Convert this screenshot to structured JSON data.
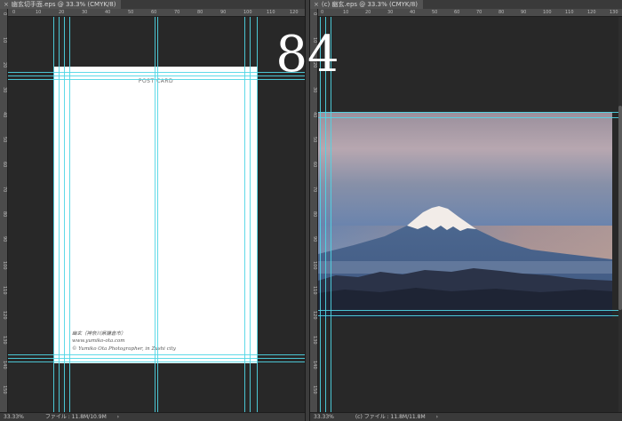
{
  "left_document": {
    "tab_title": "幽玄切手面.eps @ 33.3% (CMYK/8)",
    "ruler_top_ticks": [
      "0",
      "10",
      "20",
      "30",
      "40",
      "50",
      "60",
      "70",
      "80",
      "90",
      "100",
      "110",
      "120"
    ],
    "ruler_left_ticks": [
      "0",
      "10",
      "20",
      "30",
      "40",
      "50",
      "60",
      "70",
      "80",
      "90",
      "100",
      "110",
      "120",
      "130",
      "140",
      "150"
    ],
    "postcard": {
      "title": "POST CARD",
      "credit_lines": [
        "幽玄（神奈川県鎌倉市）",
        "www.yumiko-ota.com",
        "© Yumiko Ota Photographer, in Zushi city"
      ]
    },
    "status": {
      "zoom": "33.33%",
      "file_info": "ファイル : 11.8M/10.9M",
      "arrow": "›"
    }
  },
  "right_document": {
    "tab_title": "(c) 幽玄.eps @ 33.3% (CMYK/8)",
    "ruler_top_ticks": [
      "0",
      "10",
      "20",
      "30",
      "40",
      "50",
      "60",
      "70",
      "80",
      "90",
      "100",
      "110",
      "120",
      "130"
    ],
    "ruler_left_ticks": [
      "0",
      "10",
      "20",
      "30",
      "40",
      "50",
      "60",
      "70",
      "80",
      "90",
      "100",
      "110",
      "120",
      "130",
      "140",
      "150"
    ],
    "status": {
      "zoom": "33.33%",
      "file_info": "(c) ファイル : 11.8M/11.8M",
      "arrow": "›"
    }
  },
  "overlay": {
    "page_number": "84"
  },
  "colors": {
    "guide": "#4fd6e6",
    "workspace": "#282828",
    "ruler": "#4b4b4b"
  },
  "icons": {
    "tab_close": "close-icon",
    "status_arrow": "chevron-right-icon"
  }
}
